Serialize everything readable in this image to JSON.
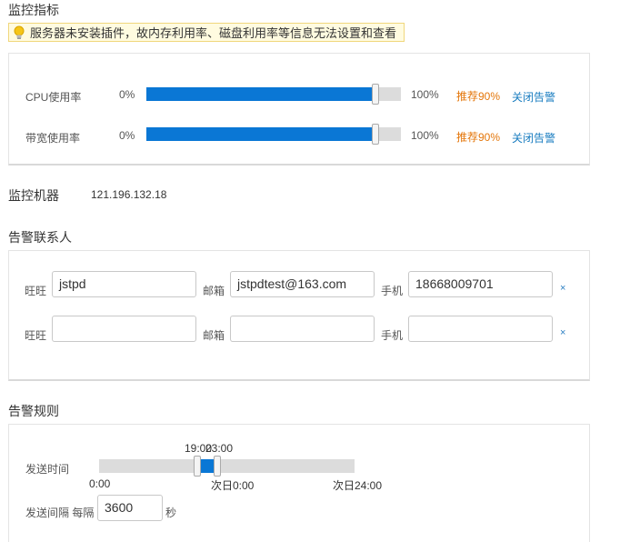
{
  "monitor": {
    "title": "监控指标",
    "notice": "服务器未安装插件，故内存利用率、磁盘利用率等信息无法设置和查看",
    "rows": [
      {
        "label": "CPU使用率",
        "min": "0%",
        "max": "100%",
        "recommend": "推荐90%",
        "action": "关闭告警",
        "value_percent": 90
      },
      {
        "label": "带宽使用率",
        "min": "0%",
        "max": "100%",
        "recommend": "推荐90%",
        "action": "关闭告警",
        "value_percent": 90
      }
    ]
  },
  "machine": {
    "label": "监控机器",
    "ip": "121.196.132.18"
  },
  "contacts": {
    "title": "告警联系人",
    "labels": {
      "wangwang": "旺旺",
      "email": "邮箱",
      "phone": "手机"
    },
    "rows": [
      {
        "wangwang": "jstpd",
        "email": "jstpdtest@163.com",
        "phone": "18668009701",
        "remove": "×"
      },
      {
        "wangwang": "",
        "email": "",
        "phone": "",
        "remove": "×"
      }
    ]
  },
  "rules": {
    "title": "告警规则",
    "send_time_label": "发送时间",
    "range_start_label": "19:00",
    "range_end_label": "23:00",
    "ticks": [
      "0:00",
      "次日0:00",
      "次日24:00"
    ],
    "interval_label": "发送间隔 每隔",
    "interval_value": "3600",
    "interval_unit": "秒"
  }
}
